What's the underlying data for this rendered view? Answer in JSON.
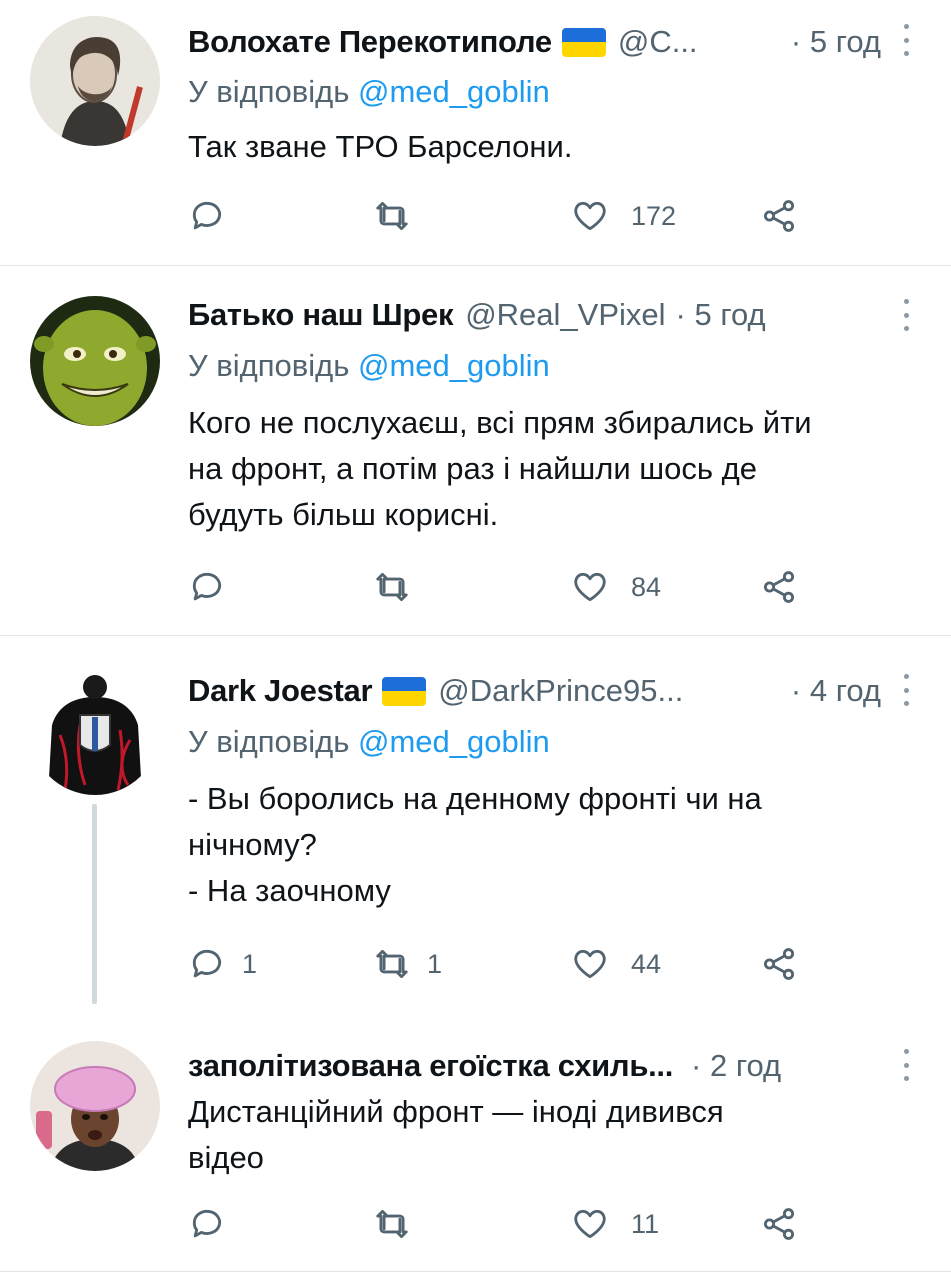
{
  "tweets": [
    {
      "name": "Волохате Перекотиполе",
      "handle": "@C...",
      "time": "· 5 год",
      "reply_prefix": "У відповідь",
      "reply_to": "@med_goblin",
      "text_lines": [
        "Так зване ТРО Барселони."
      ],
      "counts": {
        "reply": "",
        "retweet": "",
        "like": "172"
      }
    },
    {
      "name": "Батько наш Шрек",
      "handle": "@Real_VPixel",
      "time": "· 5 год",
      "reply_prefix": "У відповідь",
      "reply_to": "@med_goblin",
      "text_lines": [
        "Кого не послухаєш, всі прям збирались йти",
        "на фронт, а потім раз і найшли шось де",
        "будуть більш корисні."
      ],
      "counts": {
        "reply": "",
        "retweet": "",
        "like": "84"
      }
    },
    {
      "name": "Dark Joestar",
      "handle": "@DarkPrince95...",
      "time": "· 4 год",
      "reply_prefix": "У відповідь",
      "reply_to": "@med_goblin",
      "text_lines": [
        "- Вы боролись на денному фронті чи на",
        "нічному?",
        "- На заочному"
      ],
      "counts": {
        "reply": "1",
        "retweet": "1",
        "like": "44"
      }
    },
    {
      "name": "заполітизована егоїстка схиль...",
      "handle": "",
      "time": "· 2 год",
      "reply_prefix": "",
      "reply_to": "",
      "text_lines": [
        "Дистанційний фронт — іноді дивився",
        "відео"
      ],
      "counts": {
        "reply": "",
        "retweet": "",
        "like": "11"
      }
    }
  ],
  "colors": {
    "text": "#0f1419",
    "secondary": "#536471",
    "mention": "#1d9bf0",
    "separator": "#e1e4e8",
    "flag_blue": "#1d6ed8",
    "flag_yellow": "#ffd500"
  },
  "icons": {
    "reply": "reply-icon",
    "retweet": "retweet-icon",
    "like": "heart-icon",
    "share": "share-icon",
    "more": "more-vertical-icon"
  }
}
